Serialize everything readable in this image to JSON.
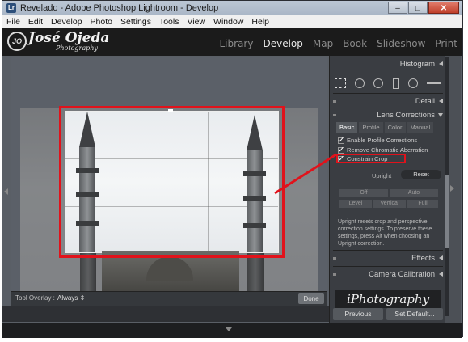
{
  "window": {
    "title": "Revelado - Adobe Photoshop Lightroom - Develop",
    "app_icon": "Lr"
  },
  "menu": [
    "File",
    "Edit",
    "Develop",
    "Photo",
    "Settings",
    "Tools",
    "View",
    "Window",
    "Help"
  ],
  "identity": {
    "logo_letters": "JO",
    "name": "José Ojeda",
    "subtitle": "Photography"
  },
  "modules": [
    {
      "label": "Library",
      "active": false
    },
    {
      "label": "Develop",
      "active": true
    },
    {
      "label": "Map",
      "active": false
    },
    {
      "label": "Book",
      "active": false
    },
    {
      "label": "Slideshow",
      "active": false
    },
    {
      "label": "Print",
      "active": false
    }
  ],
  "toolbar": {
    "overlay_label": "Tool Overlay :",
    "overlay_value": "Always ⇕",
    "done_label": "Done"
  },
  "panels": {
    "histogram": "Histogram",
    "detail": "Detail",
    "lens_corrections": "Lens Corrections",
    "effects": "Effects",
    "camera_calibration": "Camera Calibration"
  },
  "lens_tabs": [
    {
      "label": "Basic",
      "active": true
    },
    {
      "label": "Profile",
      "active": false
    },
    {
      "label": "Color",
      "active": false
    },
    {
      "label": "Manual",
      "active": false
    }
  ],
  "checkboxes": [
    {
      "label": "Enable Profile Corrections",
      "checked": true
    },
    {
      "label": "Remove Chromatic Aberration",
      "checked": true
    },
    {
      "label": "Constrain Crop",
      "checked": true
    }
  ],
  "upright": {
    "label": "Upright",
    "reset": "Reset",
    "buttons": [
      "Off",
      "Auto",
      "Level",
      "Vertical",
      "Full"
    ],
    "note": "Upright resets crop and perspective correction settings. To preserve these settings, press Alt when choosing an Upright correction."
  },
  "bottom_buttons": {
    "previous": "Previous",
    "set_default": "Set Default..."
  },
  "watermark": "iPhotography",
  "colors": {
    "highlight": "#e1121b",
    "panel": "#3a3d42",
    "identity_plate": "#1b1b1b"
  }
}
